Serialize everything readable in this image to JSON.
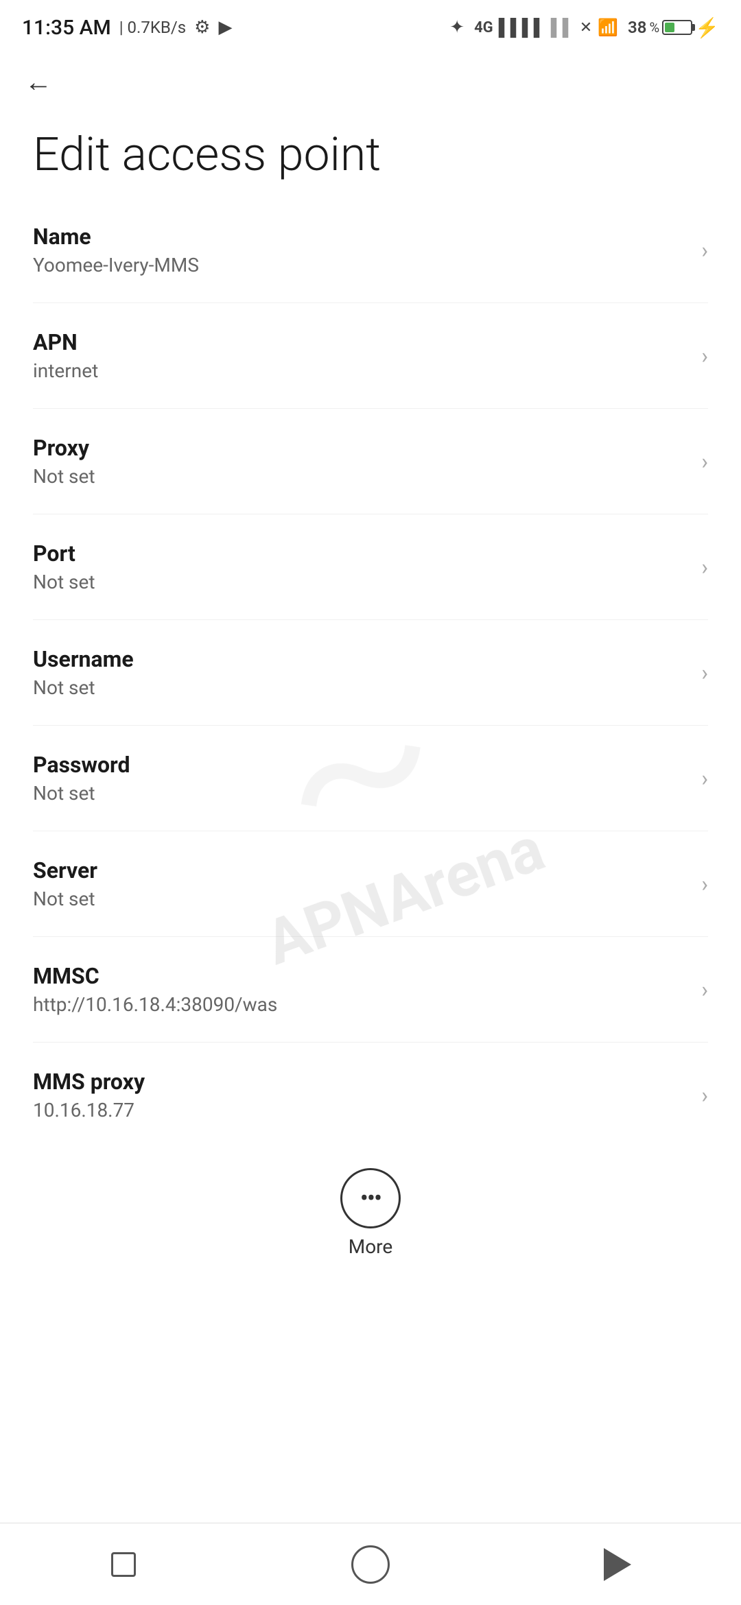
{
  "statusBar": {
    "time": "11:35 AM",
    "speed": "| 0.7KB/s",
    "batteryPercent": 38
  },
  "nav": {
    "backLabel": "←"
  },
  "page": {
    "title": "Edit access point"
  },
  "settings": [
    {
      "label": "Name",
      "value": "Yoomee-Ivery-MMS"
    },
    {
      "label": "APN",
      "value": "internet"
    },
    {
      "label": "Proxy",
      "value": "Not set"
    },
    {
      "label": "Port",
      "value": "Not set"
    },
    {
      "label": "Username",
      "value": "Not set"
    },
    {
      "label": "Password",
      "value": "Not set"
    },
    {
      "label": "Server",
      "value": "Not set"
    },
    {
      "label": "MMSC",
      "value": "http://10.16.18.4:38090/was"
    },
    {
      "label": "MMS proxy",
      "value": "10.16.18.77"
    }
  ],
  "more": {
    "label": "More"
  },
  "bottomNav": {
    "square": "recent-apps",
    "circle": "home",
    "triangle": "back"
  }
}
